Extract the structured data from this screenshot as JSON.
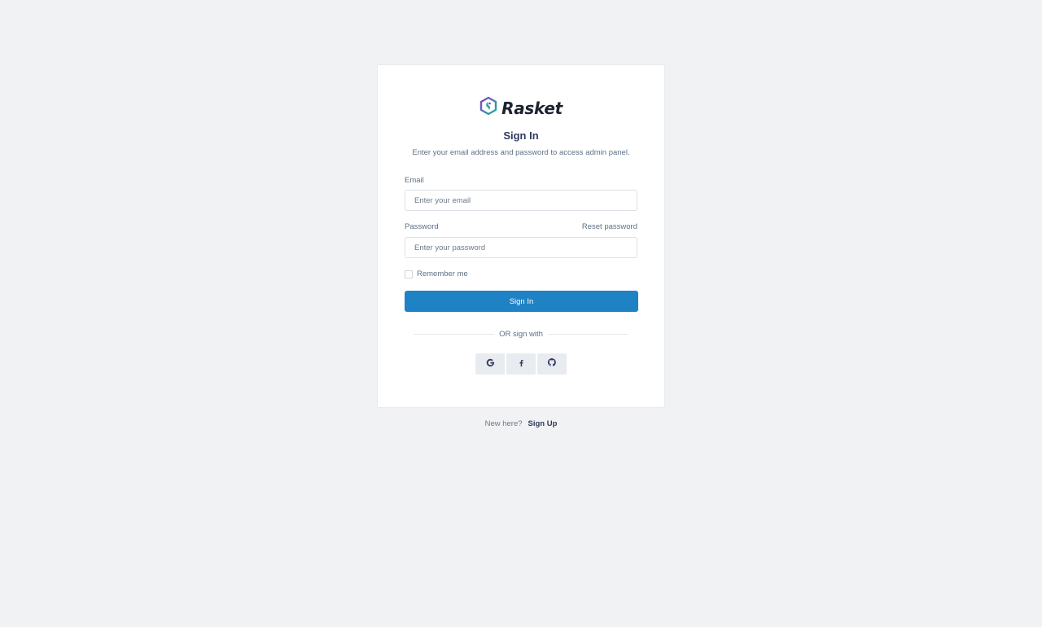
{
  "brand": {
    "name": "Rasket",
    "logo_icon": "hexagon-logo-icon"
  },
  "auth": {
    "title": "Sign In",
    "subtitle": "Enter your email address and password to access admin panel.",
    "email": {
      "label": "Email",
      "placeholder": "Enter your email",
      "value": ""
    },
    "password": {
      "label": "Password",
      "placeholder": "Enter your password",
      "value": "",
      "reset_link": "Reset password"
    },
    "remember": {
      "label": "Remember me",
      "checked": false
    },
    "submit_label": "Sign In",
    "divider_text": "OR sign with",
    "socials": [
      {
        "icon": "google-icon"
      },
      {
        "icon": "facebook-icon"
      },
      {
        "icon": "github-icon"
      }
    ]
  },
  "footer": {
    "question": "New here?",
    "link": "Sign Up"
  },
  "colors": {
    "background": "#f1f2f4",
    "primary": "#1f82c5",
    "heading": "#313b5e",
    "text": "#5d7186",
    "logo_purple": "#7b3fbf",
    "logo_teal": "#1aa9a0"
  }
}
